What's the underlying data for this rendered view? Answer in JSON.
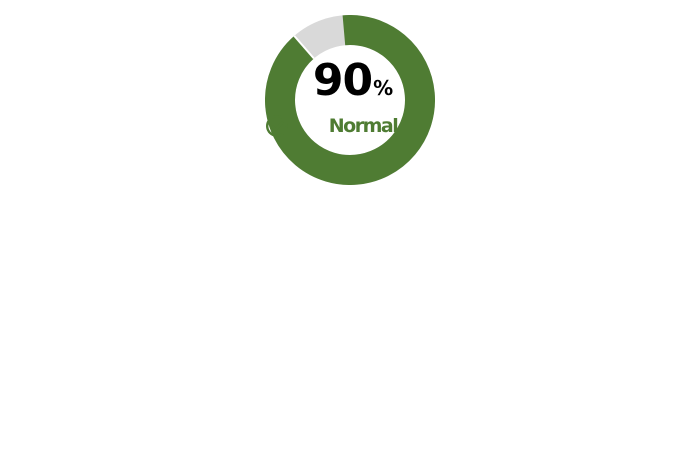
{
  "gauge": {
    "value": 90,
    "max": 100,
    "value_text": "90",
    "unit": "%",
    "status": "Normal",
    "status_icon": "check-circle-icon",
    "colors": {
      "fill": "#4f7c33",
      "track": "#d9d9d9",
      "value_text": "#000000",
      "status": "#4f7c33"
    }
  }
}
